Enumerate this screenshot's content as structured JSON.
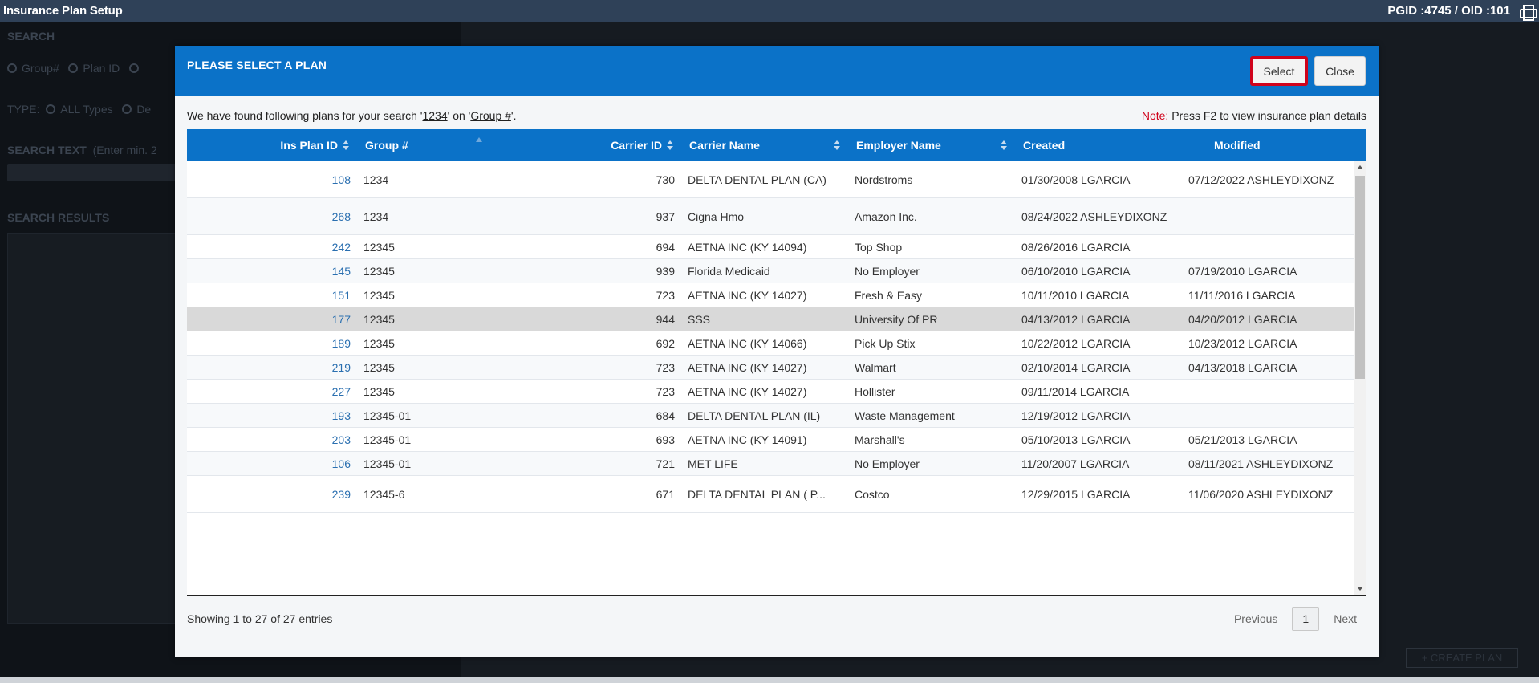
{
  "app": {
    "title": "Insurance Plan Setup",
    "ids": "PGID :4745  /  OID :101"
  },
  "background": {
    "search_label": "SEARCH",
    "radio_group": "Group#",
    "radio_plan": "Plan ID",
    "type_label": "TYPE:",
    "type_all": "ALL Types",
    "type_partial": "De",
    "search_text_label": "SEARCH TEXT",
    "search_text_hint": "(Enter min. 2",
    "results_label": "SEARCH RESULTS",
    "bottom_button": "+ CREATE PLAN"
  },
  "modal": {
    "title": "PLEASE SELECT A PLAN",
    "select_label": "Select",
    "close_label": "Close",
    "info_prefix": "We have found following plans for your search '",
    "info_search": "1234",
    "info_mid": "' on '",
    "info_field": "Group #",
    "info_suffix": "'.",
    "note_label": "Note:",
    "note_text": " Press F2 to view insurance plan details",
    "columns": [
      "Ins Plan ID",
      "Group #",
      "Carrier ID",
      "Carrier Name",
      "Employer Name",
      "Created",
      "Modified"
    ],
    "rows": [
      {
        "id": "108",
        "group": "1234",
        "carrier_id": "730",
        "carrier": "DELTA DENTAL PLAN (CA)",
        "employer": "Nordstroms",
        "created": "01/30/2008 LGARCIA",
        "modified": "07/12/2022 ASHLEYDIXONZ"
      },
      {
        "id": "268",
        "group": "1234",
        "carrier_id": "937",
        "carrier": "Cigna Hmo",
        "employer": "Amazon Inc.",
        "created": "08/24/2022 ASHLEYDIXONZ",
        "modified": ""
      },
      {
        "id": "242",
        "group": "12345",
        "carrier_id": "694",
        "carrier": "AETNA INC (KY 14094)",
        "employer": "Top Shop",
        "created": "08/26/2016 LGARCIA",
        "modified": ""
      },
      {
        "id": "145",
        "group": "12345",
        "carrier_id": "939",
        "carrier": "Florida Medicaid",
        "employer": "No Employer",
        "created": "06/10/2010 LGARCIA",
        "modified": "07/19/2010 LGARCIA"
      },
      {
        "id": "151",
        "group": "12345",
        "carrier_id": "723",
        "carrier": "AETNA INC (KY 14027)",
        "employer": "Fresh & Easy",
        "created": "10/11/2010 LGARCIA",
        "modified": "11/11/2016 LGARCIA"
      },
      {
        "id": "177",
        "group": "12345",
        "carrier_id": "944",
        "carrier": "SSS",
        "employer": "University Of PR",
        "created": "04/13/2012 LGARCIA",
        "modified": "04/20/2012 LGARCIA"
      },
      {
        "id": "189",
        "group": "12345",
        "carrier_id": "692",
        "carrier": "AETNA INC (KY 14066)",
        "employer": "Pick Up Stix",
        "created": "10/22/2012 LGARCIA",
        "modified": "10/23/2012 LGARCIA"
      },
      {
        "id": "219",
        "group": "12345",
        "carrier_id": "723",
        "carrier": "AETNA INC (KY 14027)",
        "employer": "Walmart",
        "created": "02/10/2014 LGARCIA",
        "modified": "04/13/2018 LGARCIA"
      },
      {
        "id": "227",
        "group": "12345",
        "carrier_id": "723",
        "carrier": "AETNA INC (KY 14027)",
        "employer": "Hollister",
        "created": "09/11/2014 LGARCIA",
        "modified": ""
      },
      {
        "id": "193",
        "group": "12345-01",
        "carrier_id": "684",
        "carrier": "DELTA DENTAL PLAN (IL)",
        "employer": "Waste Management",
        "created": "12/19/2012 LGARCIA",
        "modified": ""
      },
      {
        "id": "203",
        "group": "12345-01",
        "carrier_id": "693",
        "carrier": "AETNA INC (KY 14091)",
        "employer": "Marshall's",
        "created": "05/10/2013 LGARCIA",
        "modified": "05/21/2013 LGARCIA"
      },
      {
        "id": "106",
        "group": "12345-01",
        "carrier_id": "721",
        "carrier": "MET LIFE",
        "employer": "No Employer",
        "created": "11/20/2007 LGARCIA",
        "modified": "08/11/2021 ASHLEYDIXONZ"
      },
      {
        "id": "239",
        "group": "12345-6",
        "carrier_id": "671",
        "carrier": "DELTA DENTAL PLAN ( P...",
        "employer": "Costco",
        "created": "12/29/2015 LGARCIA",
        "modified": "11/06/2020 ASHLEYDIXONZ"
      }
    ],
    "showing": "Showing 1 to 27 of 27 entries",
    "pager": {
      "previous": "Previous",
      "current": "1",
      "next": "Next"
    }
  }
}
